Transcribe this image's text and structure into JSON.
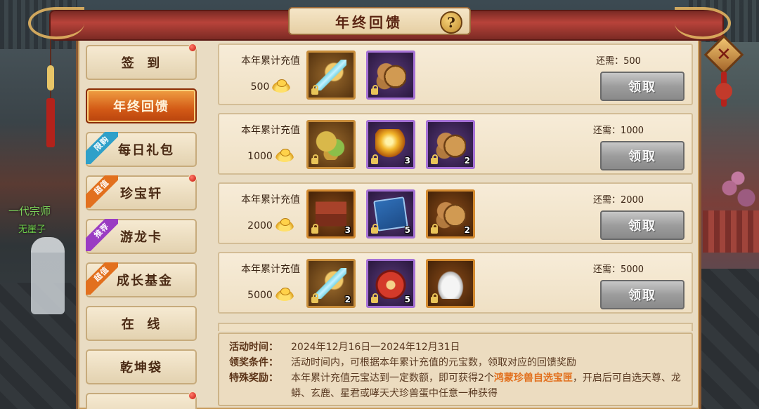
{
  "world": {
    "npc_title": "一代宗师",
    "npc_name": "无崖子"
  },
  "header": {
    "title": "年终回馈",
    "help_icon": "question-mark-icon",
    "close_icon": "close-x-icon"
  },
  "sidebar": {
    "items": [
      {
        "label": "签  到",
        "active": false,
        "tag": null,
        "red_dot": true
      },
      {
        "label": "年终回馈",
        "active": true,
        "tag": null,
        "red_dot": false
      },
      {
        "label": "每日礼包",
        "active": false,
        "tag": "限购",
        "tag_color": "#2fa0c9",
        "red_dot": false
      },
      {
        "label": "珍宝轩",
        "active": false,
        "tag": "超值",
        "tag_color": "#e2701e",
        "red_dot": true
      },
      {
        "label": "游龙卡",
        "active": false,
        "tag": "推荐",
        "tag_color": "#9a3cc3",
        "red_dot": false
      },
      {
        "label": "成长基金",
        "active": false,
        "tag": "超值",
        "tag_color": "#e2701e",
        "red_dot": false
      },
      {
        "label": "在  线",
        "active": false,
        "tag": null,
        "red_dot": false
      },
      {
        "label": "乾坤袋",
        "active": false,
        "tag": null,
        "red_dot": false
      },
      {
        "label": "",
        "active": false,
        "tag": null,
        "red_dot": true
      }
    ]
  },
  "rewards": [
    {
      "label": "本年累计充值",
      "amount": "500",
      "need_label": "还需：500",
      "claim_label": "领取",
      "items": [
        {
          "icon": "jade-sword-icon",
          "frame": "gold",
          "count": ""
        },
        {
          "icon": "copper-coins-icon",
          "frame": "purple",
          "count": ""
        }
      ]
    },
    {
      "label": "本年累计充值",
      "amount": "1000",
      "need_label": "还需：1000",
      "claim_label": "领取",
      "items": [
        {
          "icon": "gold-ore-icon",
          "frame": "gold",
          "count": ""
        },
        {
          "icon": "golden-orb-icon",
          "frame": "purple",
          "count": "3"
        },
        {
          "icon": "copper-coins-icon",
          "frame": "purple",
          "count": "2"
        }
      ]
    },
    {
      "label": "本年累计充值",
      "amount": "2000",
      "need_label": "还需：2000",
      "claim_label": "领取",
      "items": [
        {
          "icon": "gift-chest-icon",
          "frame": "orange",
          "count": "3"
        },
        {
          "icon": "skill-book-icon",
          "frame": "purple",
          "count": "5"
        },
        {
          "icon": "copper-coins-icon",
          "frame": "orange",
          "count": "2"
        }
      ]
    },
    {
      "label": "本年累计充值",
      "amount": "5000",
      "need_label": "还需：5000",
      "claim_label": "领取",
      "items": [
        {
          "icon": "jade-sword-icon",
          "frame": "gold",
          "count": "2"
        },
        {
          "icon": "red-amulet-icon",
          "frame": "purple",
          "count": "5"
        },
        {
          "icon": "silver-ingot-icon",
          "frame": "orange",
          "count": ""
        }
      ]
    }
  ],
  "info": {
    "time_key": "活动时间：",
    "time_val": "2024年12月16日一2024年12月31日",
    "cond_key": "领奖条件：",
    "cond_val": "活动时间内，可根据本年累计充值的元宝数，领取对应的回馈奖励",
    "special_key": "特殊奖励：",
    "special_val_pre": "本年累计充值元宝达到一定数额，即可获得2个",
    "special_val_hl": "鸿蒙珍兽自选宝匣",
    "special_val_post": "，开启后可自选天尊、龙蟒、玄鹿、星君或哮天犬珍兽蛋中任意一种获得"
  }
}
